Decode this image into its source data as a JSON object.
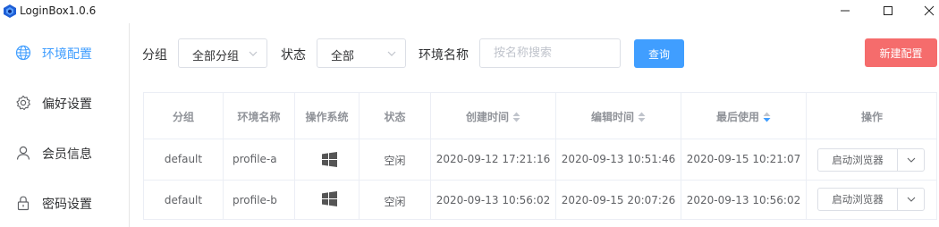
{
  "window": {
    "title": "LoginBox1.0.6",
    "logo_icon": "cube-logo-icon",
    "controls": [
      "minimize-icon",
      "maximize-icon",
      "close-icon"
    ]
  },
  "sidebar": {
    "items": [
      {
        "label": "环境配置",
        "icon": "globe-icon",
        "active": true
      },
      {
        "label": "偏好设置",
        "icon": "gear-icon",
        "active": false
      },
      {
        "label": "会员信息",
        "icon": "user-icon",
        "active": false
      },
      {
        "label": "密码设置",
        "icon": "lock-icon",
        "active": false
      }
    ]
  },
  "filters": {
    "group_label": "分组",
    "group_value": "全部分组",
    "status_label": "状态",
    "status_value": "全部",
    "name_label": "环境名称",
    "search_placeholder": "按名称搜索",
    "query_button": "查询",
    "new_button": "新建配置"
  },
  "table": {
    "headers": [
      "分组",
      "环境名称",
      "操作系统",
      "状态",
      "创建时间",
      "编辑时间",
      "最后使用",
      "操作"
    ],
    "sort_active": "最后使用",
    "rows": [
      {
        "group": "default",
        "name": "profile-a",
        "os": "windows-icon",
        "status": "空闲",
        "created": "2020-09-12 17:21:16",
        "edited": "2020-09-13 10:51:46",
        "last_used": "2020-09-15 10:21:07",
        "action": "启动浏览器"
      },
      {
        "group": "default",
        "name": "profile-b",
        "os": "windows-icon",
        "status": "空闲",
        "created": "2020-09-13 10:56:02",
        "edited": "2020-09-15 20:07:26",
        "last_used": "2020-09-13 10:56:02",
        "action": "启动浏览器"
      }
    ]
  },
  "colors": {
    "accent": "#409eff",
    "danger": "#f56c6c",
    "border": "#ebeef5"
  }
}
